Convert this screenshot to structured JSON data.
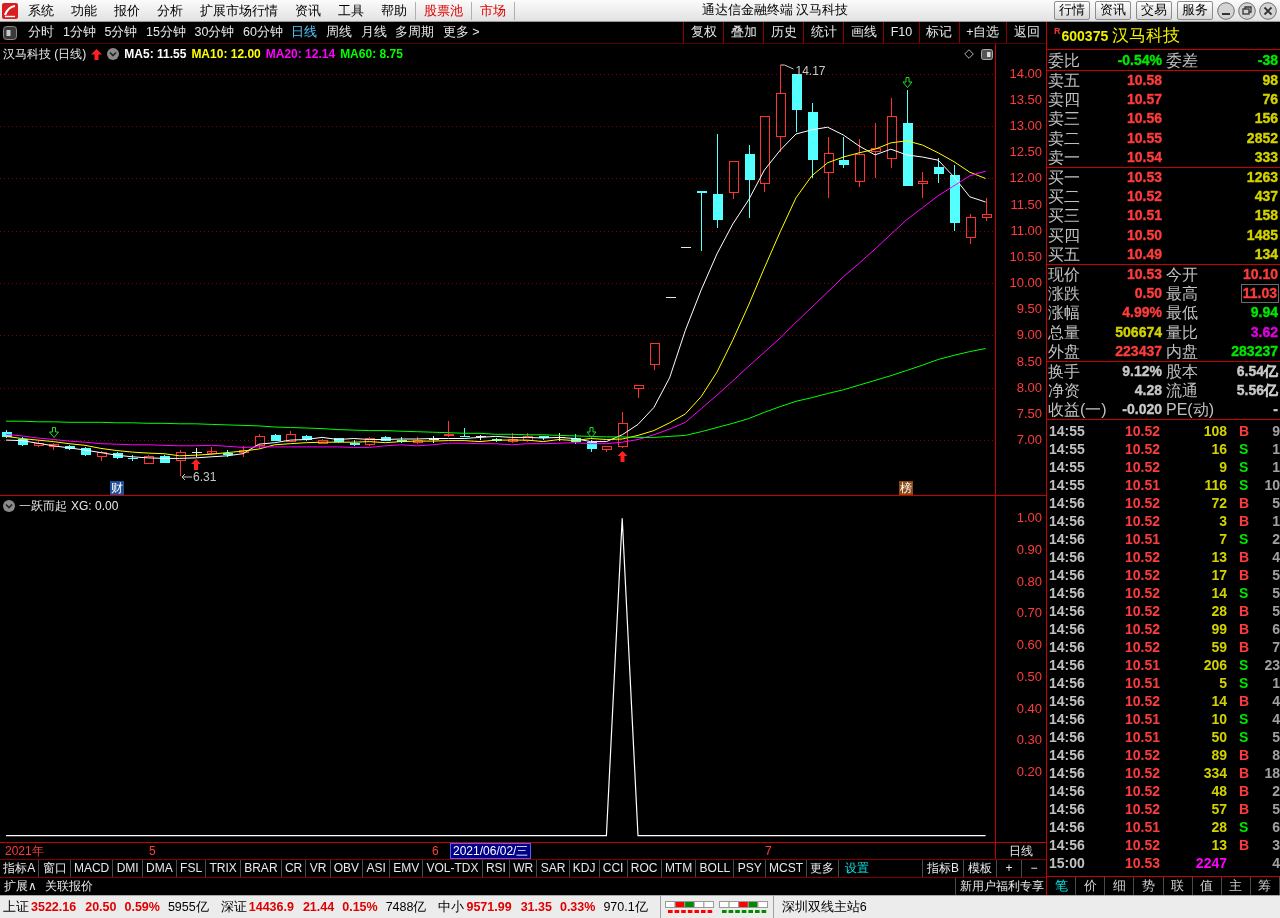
{
  "menubar": {
    "menus": [
      "系统",
      "功能",
      "报价",
      "分析",
      "扩展市场行情",
      "资讯",
      "工具",
      "帮助"
    ],
    "shortcuts": [
      "股票池",
      "市场"
    ],
    "title": "通达信金融终端  汉马科技",
    "buttons": [
      "行情",
      "资讯",
      "交易",
      "服务"
    ]
  },
  "toolbar": {
    "periods": [
      {
        "label": "分时",
        "selected": false
      },
      {
        "label": "1分钟",
        "selected": false
      },
      {
        "label": "5分钟",
        "selected": false
      },
      {
        "label": "15分钟",
        "selected": false
      },
      {
        "label": "30分钟",
        "selected": false
      },
      {
        "label": "60分钟",
        "selected": false
      },
      {
        "label": "日线",
        "selected": true
      },
      {
        "label": "周线",
        "selected": false
      },
      {
        "label": "月线",
        "selected": false
      },
      {
        "label": "多周期",
        "selected": false
      },
      {
        "label": "更多 >",
        "selected": false
      }
    ],
    "actions": [
      "复权",
      "叠加",
      "历史",
      "统计",
      "画线",
      "F10",
      "标记",
      "+自选",
      "返回"
    ]
  },
  "price_chart": {
    "title": "汉马科技 (日线)",
    "legend": [
      ": 11.55",
      ": 12.00",
      ": 12.14",
      ": 8.75"
    ],
    "chart_data": {
      "type": "candlestick",
      "ohlc": [
        [
          7.15,
          7.19,
          7.04,
          7.06
        ],
        [
          7.02,
          7.06,
          6.89,
          6.9
        ],
        [
          6.89,
          6.98,
          6.87,
          6.94
        ],
        [
          6.9,
          6.94,
          6.81,
          6.91
        ],
        [
          6.89,
          6.9,
          6.81,
          6.83
        ],
        [
          6.85,
          6.87,
          6.69,
          6.71
        ],
        [
          6.68,
          6.79,
          6.6,
          6.77
        ],
        [
          6.75,
          6.77,
          6.64,
          6.66
        ],
        [
          6.66,
          6.71,
          6.6,
          6.65
        ],
        [
          6.55,
          6.71,
          6.54,
          6.69
        ],
        [
          6.69,
          6.71,
          6.56,
          6.57
        ],
        [
          6.6,
          6.81,
          6.31,
          6.77
        ],
        [
          6.77,
          6.85,
          6.68,
          6.77
        ],
        [
          6.77,
          6.87,
          6.71,
          6.78
        ],
        [
          6.75,
          6.81,
          6.68,
          6.74
        ],
        [
          6.79,
          6.89,
          6.68,
          6.8
        ],
        [
          6.89,
          7.11,
          6.85,
          7.06
        ],
        [
          7.1,
          7.11,
          6.98,
          6.99
        ],
        [
          6.98,
          7.17,
          6.96,
          7.11
        ],
        [
          7.08,
          7.1,
          6.98,
          7.0
        ],
        [
          6.94,
          7.02,
          6.92,
          7.0
        ],
        [
          7.03,
          7.04,
          6.94,
          6.96
        ],
        [
          6.94,
          7.0,
          6.89,
          6.93
        ],
        [
          6.91,
          7.06,
          6.89,
          7.03
        ],
        [
          7.06,
          7.08,
          6.98,
          6.99
        ],
        [
          7.0,
          7.06,
          6.94,
          6.99
        ],
        [
          6.96,
          7.06,
          6.92,
          7.0
        ],
        [
          7.02,
          7.08,
          6.94,
          7.02
        ],
        [
          7.1,
          7.36,
          7.06,
          7.11
        ],
        [
          7.08,
          7.23,
          7.06,
          7.07
        ],
        [
          7.06,
          7.1,
          7.0,
          7.06
        ],
        [
          7.02,
          7.04,
          6.96,
          6.98
        ],
        [
          7.0,
          7.14,
          6.94,
          7.01
        ],
        [
          7.0,
          7.14,
          6.96,
          7.06
        ],
        [
          7.07,
          7.07,
          7.0,
          7.03
        ],
        [
          7.04,
          7.13,
          6.98,
          7.04
        ],
        [
          7.04,
          7.12,
          6.92,
          6.96
        ],
        [
          6.97,
          7.0,
          6.77,
          6.83
        ],
        [
          6.82,
          6.89,
          6.77,
          6.87
        ],
        [
          6.87,
          7.54,
          6.85,
          7.31
        ],
        [
          7.98,
          8.04,
          7.8,
          8.04
        ],
        [
          8.45,
          8.84,
          8.34,
          8.84
        ],
        [
          9.72,
          9.72,
          9.72,
          9.72
        ],
        [
          10.69,
          10.69,
          10.69,
          10.69
        ],
        [
          11.76,
          11.76,
          10.61,
          11.72
        ],
        [
          11.7,
          12.85,
          11.05,
          11.21
        ],
        [
          11.74,
          12.33,
          11.61,
          12.33
        ],
        [
          12.47,
          12.64,
          11.25,
          11.97
        ],
        [
          11.91,
          13.18,
          11.74,
          13.18
        ],
        [
          12.81,
          14.17,
          12.51,
          13.63
        ],
        [
          14.0,
          14.0,
          12.89,
          13.31
        ],
        [
          13.27,
          13.44,
          12.01,
          12.35
        ],
        [
          12.11,
          12.79,
          11.63,
          12.47
        ],
        [
          12.35,
          12.79,
          12.2,
          12.26
        ],
        [
          11.95,
          12.76,
          11.84,
          12.45
        ],
        [
          12.51,
          13.06,
          12.01,
          12.58
        ],
        [
          12.39,
          13.54,
          12.2,
          13.18
        ],
        [
          13.06,
          13.69,
          11.86,
          11.86
        ],
        [
          11.91,
          12.12,
          11.63,
          11.95
        ],
        [
          12.22,
          12.39,
          11.91,
          12.09
        ],
        [
          12.07,
          12.26,
          11.0,
          11.15
        ],
        [
          10.88,
          11.32,
          10.75,
          11.26
        ],
        [
          11.25,
          11.63,
          11.19,
          11.32
        ]
      ],
      "series": [
        {
          "name": "MA5",
          "type": "line",
          "color": "#ffffff",
          "values": [
            7.0,
            6.99,
            6.94,
            6.89,
            6.85,
            6.81,
            6.76,
            6.71,
            6.68,
            6.66,
            6.65,
            6.65,
            6.66,
            6.68,
            6.7,
            6.74,
            6.92,
            6.95,
            7.0,
            7.01,
            7.05,
            7.01,
            7.03,
            7.01,
            7.01,
            7.02,
            7.02,
            7.03,
            7.03,
            7.03,
            7.05,
            7.07,
            7.05,
            7.05,
            7.04,
            7.05,
            7.03,
            6.97,
            6.97,
            7.1,
            7.3,
            7.62,
            8.19,
            9.1,
            9.87,
            10.56,
            11.13,
            11.59,
            12.16,
            12.54,
            12.85,
            12.93,
            12.98,
            12.83,
            12.62,
            12.45,
            12.56,
            12.45,
            12.41,
            12.35,
            12.03,
            11.65,
            11.55
          ]
        },
        {
          "name": "MA10",
          "type": "line",
          "color": "#ffff00",
          "values": [
            7.07,
            7.03,
            7.0,
            6.97,
            6.93,
            6.9,
            6.84,
            6.8,
            6.77,
            6.75,
            6.74,
            6.7,
            6.71,
            6.73,
            6.76,
            6.79,
            6.83,
            6.91,
            6.93,
            6.95,
            6.96,
            6.96,
            6.96,
            6.97,
            6.95,
            6.97,
            6.98,
            6.98,
            6.99,
            6.99,
            6.97,
            7.0,
            7.0,
            7.0,
            6.97,
            7.01,
            6.99,
            7.03,
            7.01,
            7.02,
            7.09,
            7.18,
            7.33,
            7.5,
            7.83,
            8.3,
            8.91,
            9.58,
            10.29,
            10.98,
            11.63,
            12.05,
            12.3,
            12.41,
            12.49,
            12.56,
            12.68,
            12.72,
            12.64,
            12.49,
            12.32,
            12.12,
            12.0
          ]
        },
        {
          "name": "MA20",
          "type": "line",
          "color": "#ff00ff",
          "values": [
            7.11,
            7.08,
            7.04,
            7.01,
            6.98,
            6.96,
            6.93,
            6.92,
            6.91,
            6.91,
            6.9,
            6.89,
            6.89,
            6.9,
            6.88,
            6.86,
            6.87,
            6.87,
            6.87,
            6.87,
            6.87,
            6.87,
            6.86,
            6.86,
            6.89,
            6.91,
            6.89,
            6.91,
            6.94,
            6.94,
            6.93,
            6.93,
            6.91,
            6.93,
            6.93,
            6.94,
            6.95,
            6.93,
            6.93,
            6.96,
            7.01,
            7.1,
            7.21,
            7.34,
            7.6,
            7.86,
            8.13,
            8.41,
            8.68,
            8.95,
            9.25,
            9.54,
            9.83,
            10.12,
            10.38,
            10.65,
            10.93,
            11.21,
            11.44,
            11.67,
            11.86,
            12.05,
            12.14
          ]
        },
        {
          "name": "MA60",
          "type": "line",
          "color": "#00ff00",
          "values": [
            7.36,
            7.36,
            7.35,
            7.35,
            7.34,
            7.34,
            7.34,
            7.33,
            7.33,
            7.32,
            7.32,
            7.31,
            7.31,
            7.3,
            7.29,
            7.28,
            7.27,
            7.25,
            7.24,
            7.23,
            7.22,
            7.2,
            7.19,
            7.18,
            7.18,
            7.17,
            7.16,
            7.15,
            7.14,
            7.13,
            7.13,
            7.11,
            7.11,
            7.1,
            7.1,
            7.09,
            7.08,
            7.07,
            7.06,
            7.06,
            7.05,
            7.05,
            7.07,
            7.09,
            7.16,
            7.24,
            7.32,
            7.41,
            7.53,
            7.64,
            7.74,
            7.81,
            7.89,
            7.96,
            8.05,
            8.14,
            8.23,
            8.33,
            8.43,
            8.54,
            8.62,
            8.69,
            8.75
          ]
        }
      ],
      "ylim": [
        5.95,
        14.57
      ],
      "grid": true,
      "yticks": [
        {
          "value": 14,
          "label": "14.00"
        },
        {
          "value": 13.5,
          "label": "13.50"
        },
        {
          "value": 13,
          "label": "13.00"
        },
        {
          "value": 12.5,
          "label": "12.50"
        },
        {
          "value": 12,
          "label": "12.00"
        },
        {
          "value": 11.5,
          "label": "11.50"
        },
        {
          "value": 11,
          "label": "11.00"
        },
        {
          "value": 10.5,
          "label": "10.50"
        },
        {
          "value": 10,
          "label": "10.00"
        },
        {
          "value": 9.5,
          "label": "9.50"
        },
        {
          "value": 9,
          "label": "9.00"
        },
        {
          "value": 8.5,
          "label": "8.50"
        },
        {
          "value": 8,
          "label": "8.00"
        },
        {
          "value": 7.5,
          "label": "7.50"
        },
        {
          "value": 7,
          "label": "7.00"
        }
      ]
    },
    "high_label": "14.17",
    "low_label": "6.31",
    "event_tags": [
      {
        "label": "财",
        "kind": "finance"
      },
      {
        "label": "榜",
        "kind": "ranking"
      }
    ]
  },
  "indicator": {
    "title": "一跃而起",
    "legend": [
      ": 0.00"
    ],
    "chart_data": {
      "type": "line",
      "series": [
        {
          "name": "XG",
          "color": "#ffffff",
          "values": [
            0,
            0,
            0,
            0,
            0,
            0,
            0,
            0,
            0,
            0,
            0,
            0,
            0,
            0,
            0,
            0,
            0,
            0,
            0,
            0,
            0,
            0,
            0,
            0,
            0,
            0,
            0,
            0,
            0,
            0,
            0,
            0,
            0,
            0,
            0,
            0,
            0,
            0,
            0,
            1,
            0,
            0,
            0,
            0,
            0,
            0,
            0,
            0,
            0,
            0,
            0,
            0,
            0,
            0,
            0,
            0,
            0,
            0,
            0,
            0,
            0,
            0,
            0
          ]
        }
      ],
      "ylim": [
        -0.02,
        1.07
      ],
      "yticks": [
        {
          "value": 1,
          "label": "1.00"
        },
        {
          "value": 0.9,
          "label": "0.90"
        },
        {
          "value": 0.8,
          "label": "0.80"
        },
        {
          "value": 0.7,
          "label": "0.70"
        },
        {
          "value": 0.6,
          "label": "0.60"
        },
        {
          "value": 0.5,
          "label": "0.50"
        },
        {
          "value": 0.4,
          "label": "0.40"
        },
        {
          "value": 0.3,
          "label": "0.30"
        },
        {
          "value": 0.2,
          "label": "0.20"
        }
      ]
    }
  },
  "date_axis": {
    "labels": [
      {
        "text": "2021年",
        "kind": "tick"
      },
      {
        "text": "5",
        "kind": "tick"
      },
      {
        "text": "6",
        "kind": "tick"
      },
      {
        "text": "2021/06/02/三",
        "kind": "cursor"
      },
      {
        "text": "7",
        "kind": "tick"
      }
    ],
    "period": "日线"
  },
  "indicator_bar": {
    "tabs": [
      "指标A",
      "窗口",
      "MACD",
      "DMI",
      "DMA",
      "FSL",
      "TRIX",
      "BRAR",
      "CR",
      "VR",
      "OBV",
      "ASI",
      "EMV",
      "VOL-TDX",
      "RSI",
      "WR",
      "SAR",
      "KDJ",
      "CCI",
      "ROC",
      "MTM",
      "BOLL",
      "PSY",
      "MCST",
      "更多"
    ],
    "settings": "设置",
    "right": [
      "指标B",
      "模板"
    ],
    "zoom": [
      "+",
      "−"
    ]
  },
  "extension_bar": {
    "items": [
      "扩展∧",
      "关联报价"
    ],
    "promo": "新用户福利专享"
  },
  "quote_panel": {
    "tag": "R",
    "code": "600375",
    "name": "汉马科技",
    "order_ratio": [
      {
        "label": "委比",
        "value": "-0.54%"
      },
      {
        "label": "委差",
        "value": "-38"
      }
    ],
    "asks": [
      {
        "label": "卖五",
        "price": "10.58",
        "volume": "98"
      },
      {
        "label": "卖四",
        "price": "10.57",
        "volume": "76"
      },
      {
        "label": "卖三",
        "price": "10.56",
        "volume": "156"
      },
      {
        "label": "卖二",
        "price": "10.55",
        "volume": "2852"
      },
      {
        "label": "卖一",
        "price": "10.54",
        "volume": "333"
      }
    ],
    "bids": [
      {
        "label": "买一",
        "price": "10.53",
        "volume": "1263"
      },
      {
        "label": "买二",
        "price": "10.52",
        "volume": "437"
      },
      {
        "label": "买三",
        "price": "10.51",
        "volume": "158"
      },
      {
        "label": "买四",
        "price": "10.50",
        "volume": "1485"
      },
      {
        "label": "买五",
        "price": "10.49",
        "volume": "134"
      }
    ],
    "stats": [
      {
        "label": "现价",
        "value": "10.53",
        "color": "#ff3c3c",
        "framed": false
      },
      {
        "label": "今开",
        "value": "10.10",
        "color": "#ff3c3c",
        "framed": false
      },
      {
        "label": "涨跌",
        "value": "0.50",
        "color": "#ff3c3c",
        "framed": false
      },
      {
        "label": "最高",
        "value": "11.03",
        "color": "#ff3c3c",
        "framed": true
      },
      {
        "label": "涨幅",
        "value": "4.99%",
        "color": "#ff3c3c",
        "framed": false
      },
      {
        "label": "最低",
        "value": "9.94",
        "color": "#00e600",
        "framed": false
      },
      {
        "label": "总量",
        "value": "506674",
        "color": "#d2d200",
        "framed": false
      },
      {
        "label": "量比",
        "value": "3.62",
        "color": "#e000e0",
        "framed": false
      },
      {
        "label": "外盘",
        "value": "223437",
        "color": "#ff3c3c",
        "framed": false
      },
      {
        "label": "内盘",
        "value": "283237",
        "color": "#00e600",
        "framed": false
      }
    ],
    "fundamentals": [
      {
        "label": "换手",
        "value": "9.12%"
      },
      {
        "label": "股本",
        "value": "6.54亿"
      },
      {
        "label": "净资",
        "value": "4.28"
      },
      {
        "label": "流通",
        "value": "5.56亿"
      },
      {
        "label": "收益(一)",
        "value": "-0.020"
      },
      {
        "label": "PE(动)",
        "value": "-"
      }
    ],
    "ticks": [
      {
        "time": "14:55",
        "price": "10.52",
        "volume": "108",
        "color": "#d2d200",
        "side": "B",
        "kind": "buy",
        "count": "9"
      },
      {
        "time": "14:55",
        "price": "10.52",
        "volume": "16",
        "color": "#d2d200",
        "side": "S",
        "kind": "sell",
        "count": "1"
      },
      {
        "time": "14:55",
        "price": "10.52",
        "volume": "9",
        "color": "#d2d200",
        "side": "S",
        "kind": "sell",
        "count": "1"
      },
      {
        "time": "14:55",
        "price": "10.51",
        "volume": "116",
        "color": "#d2d200",
        "side": "S",
        "kind": "sell",
        "count": "10"
      },
      {
        "time": "14:56",
        "price": "10.52",
        "volume": "72",
        "color": "#d2d200",
        "side": "B",
        "kind": "buy",
        "count": "5"
      },
      {
        "time": "14:56",
        "price": "10.52",
        "volume": "3",
        "color": "#d2d200",
        "side": "B",
        "kind": "buy",
        "count": "1"
      },
      {
        "time": "14:56",
        "price": "10.51",
        "volume": "7",
        "color": "#d2d200",
        "side": "S",
        "kind": "sell",
        "count": "2"
      },
      {
        "time": "14:56",
        "price": "10.52",
        "volume": "13",
        "color": "#d2d200",
        "side": "B",
        "kind": "buy",
        "count": "4"
      },
      {
        "time": "14:56",
        "price": "10.52",
        "volume": "17",
        "color": "#d2d200",
        "side": "B",
        "kind": "buy",
        "count": "5"
      },
      {
        "time": "14:56",
        "price": "10.52",
        "volume": "14",
        "color": "#d2d200",
        "side": "S",
        "kind": "sell",
        "count": "5"
      },
      {
        "time": "14:56",
        "price": "10.52",
        "volume": "28",
        "color": "#d2d200",
        "side": "B",
        "kind": "buy",
        "count": "5"
      },
      {
        "time": "14:56",
        "price": "10.52",
        "volume": "99",
        "color": "#d2d200",
        "side": "B",
        "kind": "buy",
        "count": "6"
      },
      {
        "time": "14:56",
        "price": "10.52",
        "volume": "59",
        "color": "#d2d200",
        "side": "B",
        "kind": "buy",
        "count": "7"
      },
      {
        "time": "14:56",
        "price": "10.51",
        "volume": "206",
        "color": "#d2d200",
        "side": "S",
        "kind": "sell",
        "count": "23"
      },
      {
        "time": "14:56",
        "price": "10.51",
        "volume": "5",
        "color": "#d2d200",
        "side": "S",
        "kind": "sell",
        "count": "1"
      },
      {
        "time": "14:56",
        "price": "10.52",
        "volume": "14",
        "color": "#d2d200",
        "side": "B",
        "kind": "buy",
        "count": "4"
      },
      {
        "time": "14:56",
        "price": "10.51",
        "volume": "10",
        "color": "#d2d200",
        "side": "S",
        "kind": "sell",
        "count": "4"
      },
      {
        "time": "14:56",
        "price": "10.51",
        "volume": "50",
        "color": "#d2d200",
        "side": "S",
        "kind": "sell",
        "count": "5"
      },
      {
        "time": "14:56",
        "price": "10.52",
        "volume": "89",
        "color": "#d2d200",
        "side": "B",
        "kind": "buy",
        "count": "8"
      },
      {
        "time": "14:56",
        "price": "10.52",
        "volume": "334",
        "color": "#d2d200",
        "side": "B",
        "kind": "buy",
        "count": "18"
      },
      {
        "time": "14:56",
        "price": "10.52",
        "volume": "48",
        "color": "#d2d200",
        "side": "B",
        "kind": "buy",
        "count": "2"
      },
      {
        "time": "14:56",
        "price": "10.52",
        "volume": "57",
        "color": "#d2d200",
        "side": "B",
        "kind": "buy",
        "count": "5"
      },
      {
        "time": "14:56",
        "price": "10.51",
        "volume": "28",
        "color": "#d2d200",
        "side": "S",
        "kind": "sell",
        "count": "6"
      },
      {
        "time": "14:56",
        "price": "10.52",
        "volume": "13",
        "color": "#d2d200",
        "side": "B",
        "kind": "buy",
        "count": "3"
      },
      {
        "time": "15:00",
        "price": "10.53",
        "volume": "2247",
        "color": "#ff00ff",
        "count": "4"
      }
    ],
    "tabs": [
      {
        "label": "笔",
        "selected": true
      },
      {
        "label": "价",
        "selected": false
      },
      {
        "label": "细",
        "selected": false
      },
      {
        "label": "势",
        "selected": false
      },
      {
        "label": "联",
        "selected": false
      },
      {
        "label": "值",
        "selected": false
      },
      {
        "label": "主",
        "selected": false
      },
      {
        "label": "筹",
        "selected": false
      }
    ]
  },
  "status_bar": {
    "indices": [
      {
        "name": "上证",
        "value": "3522.16",
        "change": "20.50",
        "percent": "0.59%",
        "turnover": "5955亿",
        "color": "#e00000"
      },
      {
        "name": "深证",
        "value": "14436.9",
        "change": "21.44",
        "percent": "0.15%",
        "turnover": "7488亿",
        "color": "#e00000"
      },
      {
        "name": "中小",
        "value": "9571.99",
        "change": "31.35",
        "percent": "0.33%",
        "turnover": "970.1亿",
        "color": "#e00000"
      }
    ],
    "server": "深圳双线主站6"
  }
}
